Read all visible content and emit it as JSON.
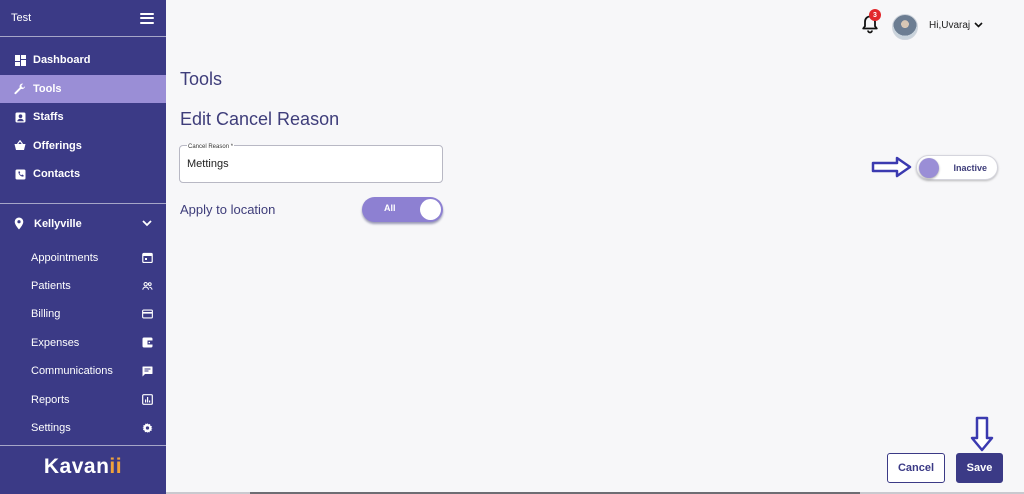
{
  "sidebar": {
    "app_title": "Test",
    "items": [
      {
        "label": "Dashboard",
        "icon": "dashboard-icon"
      },
      {
        "label": "Tools",
        "icon": "wrench-icon",
        "active": true
      },
      {
        "label": "Staffs",
        "icon": "badge-icon"
      },
      {
        "label": "Offerings",
        "icon": "basket-icon"
      },
      {
        "label": "Contacts",
        "icon": "phone-book-icon"
      }
    ],
    "location": "Kellyville",
    "sub_items": [
      {
        "label": "Appointments",
        "icon": "calendar-icon"
      },
      {
        "label": "Patients",
        "icon": "people-icon"
      },
      {
        "label": "Billing",
        "icon": "credit-card-icon"
      },
      {
        "label": "Expenses",
        "icon": "wallet-icon"
      },
      {
        "label": "Communications",
        "icon": "chat-icon"
      },
      {
        "label": "Reports",
        "icon": "report-chart-icon"
      },
      {
        "label": "Settings",
        "icon": "gear-icon"
      }
    ],
    "logo_main": "Kavan",
    "logo_accent": "ii"
  },
  "header": {
    "notification_count": "3",
    "greeting": "Hi,Uvaraj"
  },
  "main": {
    "page_title": "Tools",
    "section_title": "Edit Cancel Reason",
    "cancel_reason_label": "Cancel Reason *",
    "cancel_reason_value": "Mettings",
    "apply_label": "Apply to location",
    "apply_toggle_label": "All",
    "status_toggle_label": "Inactive",
    "cancel_button": "Cancel",
    "save_button": "Save"
  },
  "colors": {
    "sidebar_bg": "#3b3a86",
    "active_item": "#9a8ed6",
    "toggle_on": "#8d80d2",
    "badge": "#e2272b",
    "logo_accent": "#f0a23b"
  }
}
